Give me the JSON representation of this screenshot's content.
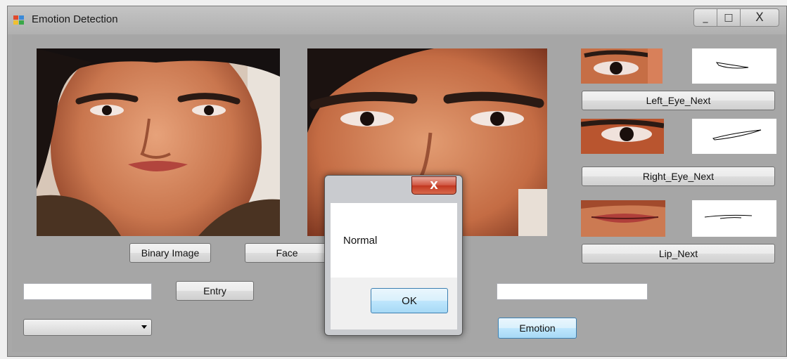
{
  "window": {
    "title": "Emotion Detection",
    "minimize_glyph": "_",
    "maximize_glyph": "□",
    "close_glyph": "X"
  },
  "buttons": {
    "binary_image": "Binary Image",
    "face": "Face",
    "entry": "Entry",
    "emotion": "Emotion",
    "left_eye_next": "Left_Eye_Next",
    "right_eye_next": "Right_Eye_Next",
    "lip_next": "Lip_Next"
  },
  "inputs": {
    "entry_text": "",
    "emotion_text": "",
    "combo_selected": ""
  },
  "dialog": {
    "message": "Normal",
    "ok_label": "OK",
    "close_glyph": "X"
  },
  "icons": [
    "app-icon",
    "minimize-icon",
    "maximize-icon",
    "close-icon",
    "dropdown-arrow-icon"
  ],
  "colors": {
    "window_bg": "#a6a6a6",
    "button_focus": "#3c7fb1",
    "dialog_close": "#c23720"
  }
}
